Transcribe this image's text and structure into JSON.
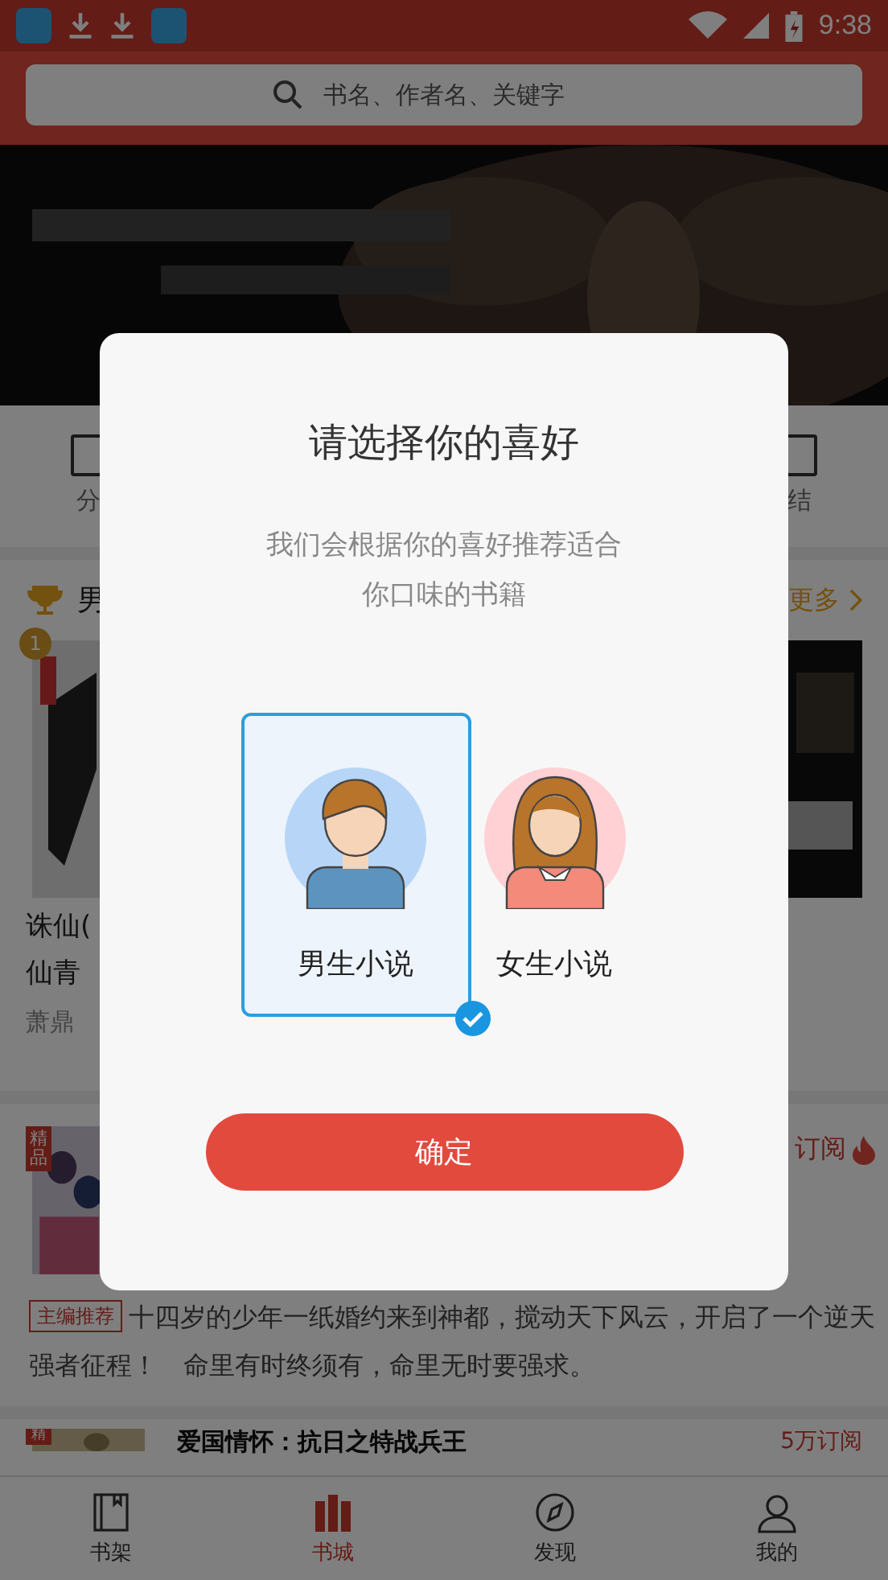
{
  "status_bar": {
    "time": "9:38"
  },
  "search": {
    "placeholder": "书名、作者名、关键字"
  },
  "categories": [
    {
      "label": "分"
    },
    {
      "label": "结"
    }
  ],
  "section": {
    "title": "男",
    "more": "更多"
  },
  "ranked_book": {
    "rank": "1",
    "title_lines": [
      "诛仙(",
      "仙青"
    ],
    "author": "萧鼎"
  },
  "featured_book": {
    "tag": "精品",
    "subscriptions": "订阅",
    "badge": "主编推荐",
    "description": "十四岁的少年一纸婚约来到神都，搅动天下风云，开启了一个逆天强者征程！　命里有时终须有，命里无时要强求。"
  },
  "next_book": {
    "tag": "精",
    "title": "爱国情怀：抗日之特战兵王",
    "subscriptions": "5万订阅"
  },
  "dialog": {
    "title": "请选择你的喜好",
    "message_lines": [
      "我们会根据你的喜好推荐适合",
      "你口味的书籍"
    ],
    "options": [
      {
        "kind": "male",
        "label": "男生小说",
        "selected": true
      },
      {
        "kind": "female",
        "label": "女生小说",
        "selected": false
      }
    ],
    "confirm": "确定"
  },
  "tabs": [
    {
      "kind": "shelf",
      "label": "书架",
      "selected": false
    },
    {
      "kind": "store",
      "label": "书城",
      "selected": true
    },
    {
      "kind": "discover",
      "label": "发现",
      "selected": false
    },
    {
      "kind": "me",
      "label": "我的",
      "selected": false
    }
  ]
}
